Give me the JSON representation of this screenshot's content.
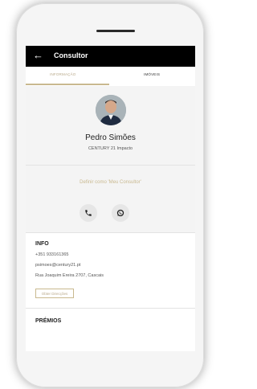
{
  "header": {
    "title": "Consultor",
    "back_icon": "arrow-left-icon"
  },
  "tabs": [
    {
      "label": "Informação",
      "active": true
    },
    {
      "label": "Imóveis",
      "active": false
    }
  ],
  "profile": {
    "name": "Pedro Simões",
    "company": "CENTURY 21 Impacto"
  },
  "actions": {
    "define_label": "Definir como 'Meu Consultor'",
    "call_icon": "phone-icon",
    "whatsapp_icon": "whatsapp-icon"
  },
  "info": {
    "title": "INFO",
    "phone": "+351 933161365",
    "email": "psimoes@century21.pt",
    "address": "Rua Joaquim Ereira 2707, Cascais",
    "directions_label": "Obter Direcções"
  },
  "premios": {
    "title": "PRÉMIOS"
  },
  "colors": {
    "accent": "#c9b98f",
    "topbar": "#000000"
  }
}
